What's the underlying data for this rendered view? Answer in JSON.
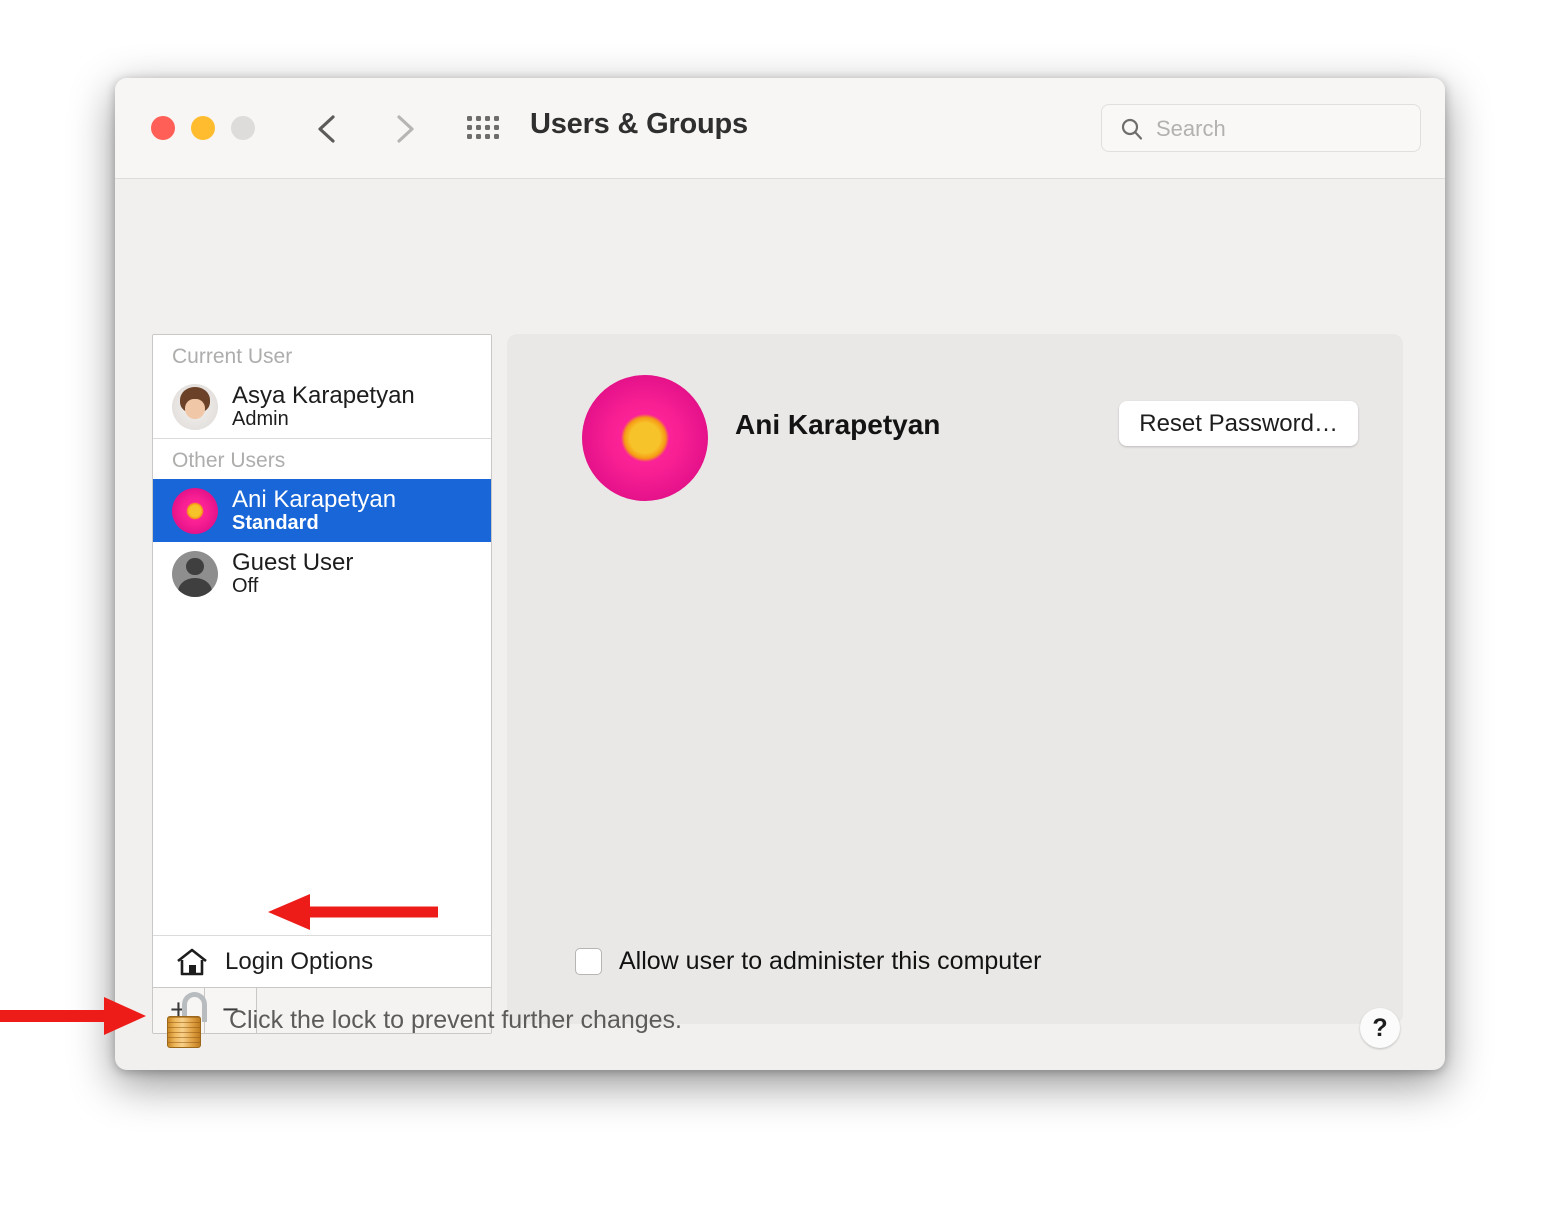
{
  "window": {
    "title": "Users & Groups",
    "traffic_lights": [
      {
        "name": "close",
        "color": "#ff5f57"
      },
      {
        "name": "minimize",
        "color": "#febc2e"
      },
      {
        "name": "zoom",
        "color": "#dddcda"
      }
    ],
    "nav": {
      "back_icon": "chevron-left-icon",
      "forward_icon": "chevron-right-icon",
      "grid_icon": "grid-apps-icon"
    }
  },
  "search": {
    "placeholder": "Search",
    "value": "",
    "icon": "search-icon"
  },
  "sidebar": {
    "groups": [
      {
        "header": "Current User",
        "users": [
          {
            "name": "Asya Karapetyan",
            "role": "Admin",
            "avatar": "memoji-avatar",
            "selected": false
          }
        ]
      },
      {
        "header": "Other Users",
        "users": [
          {
            "name": "Ani Karapetyan",
            "role": "Standard",
            "avatar": "flower-avatar",
            "selected": true
          },
          {
            "name": "Guest User",
            "role": "Off",
            "avatar": "person-silhouette-avatar",
            "selected": false
          }
        ]
      }
    ],
    "login_options": {
      "label": "Login Options",
      "icon": "house-icon"
    },
    "add_button": "+",
    "remove_button": "−"
  },
  "detail": {
    "avatar": "flower-avatar",
    "name": "Ani Karapetyan",
    "reset_password_label": "Reset Password…",
    "admin_checkbox": {
      "label": "Allow user to administer this computer",
      "checked": false
    }
  },
  "footer": {
    "lock_icon": "unlocked-padlock-icon",
    "lock_text": "Click the lock to prevent further changes.",
    "help_label": "?"
  },
  "annotations": {
    "accent_color": "#ee1c18",
    "arrow_to_remove_button": "arrow-pointing-to-remove-user-button",
    "arrow_to_lock": "arrow-pointing-to-lock-icon"
  },
  "colors": {
    "selection_blue": "#1866d7",
    "window_background": "#f1f0ef",
    "panel_background": "#e9e8e7"
  }
}
